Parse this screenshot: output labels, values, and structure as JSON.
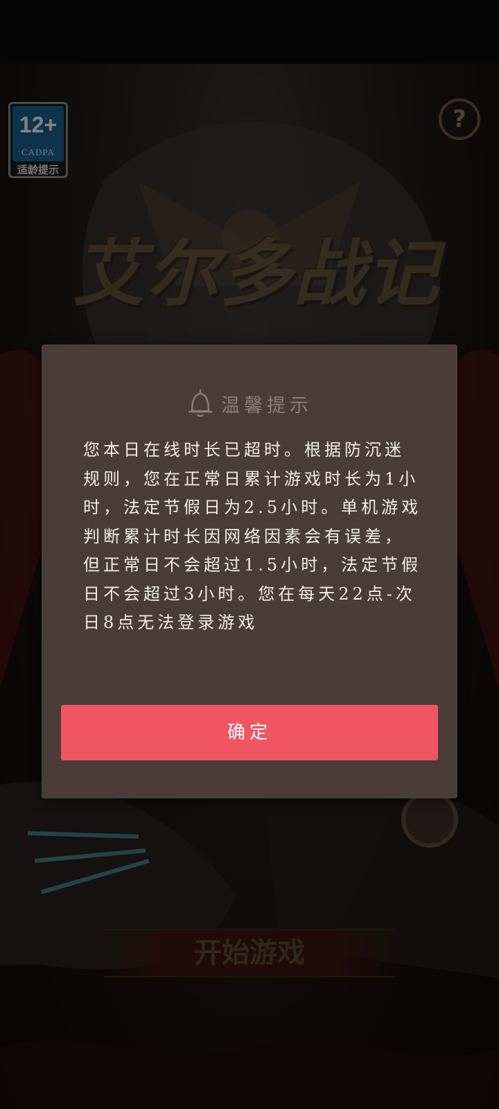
{
  "age_badge": {
    "rating": "12+",
    "org": "CADPA",
    "label": "适龄提示"
  },
  "help": {
    "icon": "?"
  },
  "game": {
    "title": "艾尔多战记",
    "start_label": "开始游戏"
  },
  "dialog": {
    "title": "温馨提示",
    "message": "您本日在线时长已超时。根据防沉迷规则，您在正常日累计游戏时长为1小时，法定节假日为2.5小时。单机游戏判断累计时长因网络因素会有误差，但正常日不会超过1.5小时，法定节假日不会超过3小时。您在每天22点-次日8点无法登录游戏",
    "confirm_label": "确定"
  },
  "colors": {
    "dialog_bg": "#4a3c38",
    "confirm_button": "#f05563",
    "badge_blue": "#1f6fa8"
  }
}
